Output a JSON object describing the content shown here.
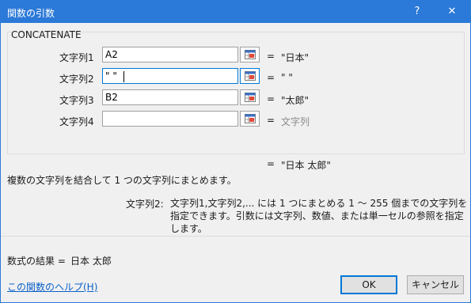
{
  "window": {
    "title": "関数の引数",
    "help_glyph": "?",
    "close_glyph": "✕"
  },
  "function": {
    "name": "CONCATENATE"
  },
  "arguments": [
    {
      "label": "文字列1",
      "value": "A2",
      "result": "\"日本\"",
      "eq": "="
    },
    {
      "label": "文字列2",
      "value": "\" \"",
      "result": "\" \"",
      "eq": "="
    },
    {
      "label": "文字列3",
      "value": "B2",
      "result": "\"太郎\"",
      "eq": "="
    },
    {
      "label": "文字列4",
      "value": "",
      "result": "文字列",
      "eq": "="
    }
  ],
  "result": {
    "eq": "=",
    "value": "\"日本 太郎\""
  },
  "description": "複数の文字列を結合して 1 つの文字列にまとめます。",
  "arg_description": {
    "name": "文字列2:",
    "text": "文字列1,文字列2,... には 1 つにまとめる 1 ～ 255 個までの文字列を指定できます。引数には文字列、数値、または単一セルの参照を指定します。"
  },
  "formula_result": {
    "label": "数式の結果 =",
    "value": "日本 太郎"
  },
  "help_link": "この関数のヘルプ(H)",
  "buttons": {
    "ok": "OK",
    "cancel": "キャンセル"
  },
  "icons": {
    "help": "help-icon",
    "close": "close-icon",
    "range_select": "range-select-icon"
  }
}
